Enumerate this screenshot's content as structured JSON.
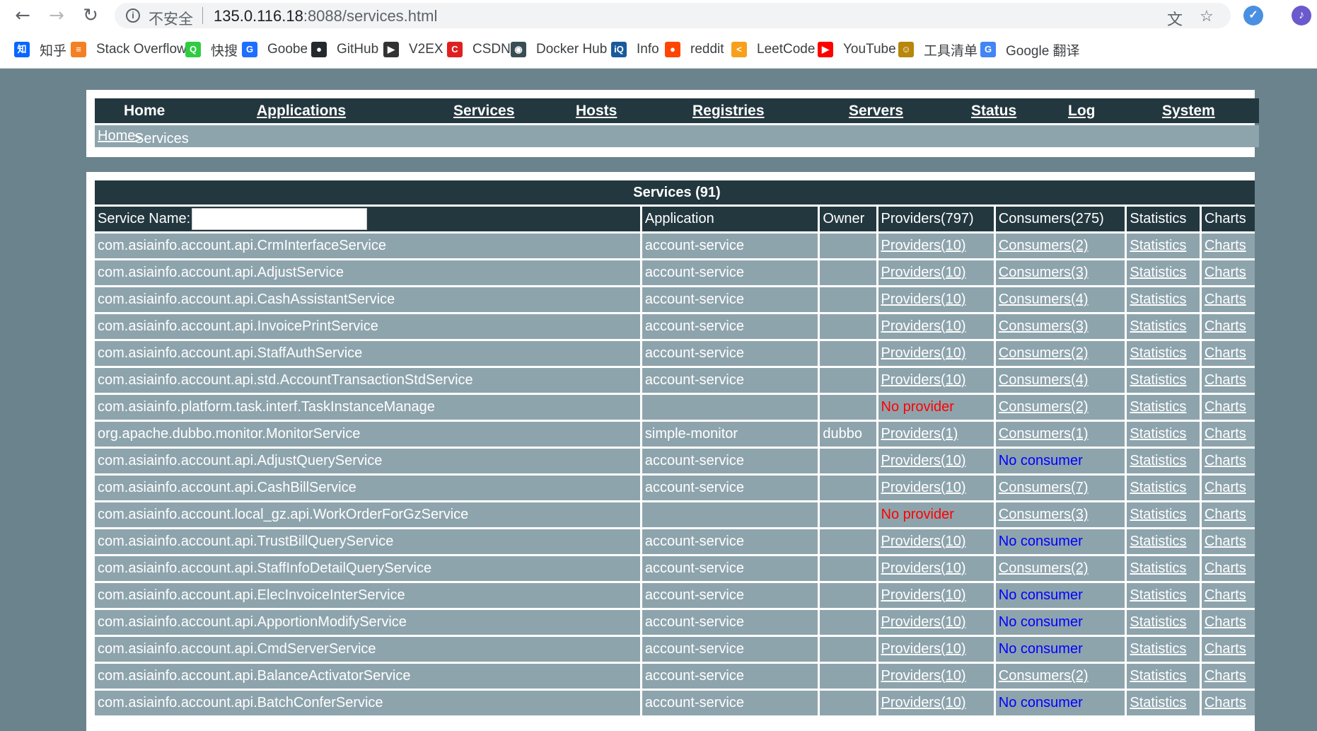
{
  "browser": {
    "insecure_label": "不安全",
    "url_host": "135.0.116.18",
    "url_rest": ":8088/services.html",
    "bookmarks": [
      {
        "label": "知乎",
        "icon": "zhihu-icon",
        "color": "#0a66ff",
        "glyph": "知"
      },
      {
        "label": "Stack Overflow",
        "icon": "stackoverflow-icon",
        "color": "#f48024",
        "glyph": "≡"
      },
      {
        "label": "快搜",
        "icon": "kuaisou-icon",
        "color": "#2ecc40",
        "glyph": "Q"
      },
      {
        "label": "Goobe",
        "icon": "goobe-icon",
        "color": "#1e6fff",
        "glyph": "G"
      },
      {
        "label": "GitHub",
        "icon": "github-icon",
        "color": "#24292e",
        "glyph": "●"
      },
      {
        "label": "V2EX",
        "icon": "v2ex-icon",
        "color": "#333333",
        "glyph": "▶"
      },
      {
        "label": "CSDN",
        "icon": "csdn-icon",
        "color": "#e02020",
        "glyph": "C"
      },
      {
        "label": "Docker Hub",
        "icon": "dockerhub-icon",
        "color": "#394d54",
        "glyph": "◉"
      },
      {
        "label": "Info",
        "icon": "infoq-icon",
        "color": "#1a5a9c",
        "glyph": "iQ"
      },
      {
        "label": "reddit",
        "icon": "reddit-icon",
        "color": "#ff4500",
        "glyph": "●"
      },
      {
        "label": "LeetCode",
        "icon": "leetcode-icon",
        "color": "#f89f1b",
        "glyph": "<"
      },
      {
        "label": "YouTube",
        "icon": "youtube-icon",
        "color": "#ff0000",
        "glyph": "▶"
      },
      {
        "label": "工具清单",
        "icon": "toolkit-icon",
        "color": "#b8860b",
        "glyph": "☺"
      },
      {
        "label": "Google 翻译",
        "icon": "google-translate-icon",
        "color": "#4285f4",
        "glyph": "G"
      }
    ]
  },
  "nav": {
    "items": [
      "Home",
      "Applications",
      "Services",
      "Hosts",
      "Registries",
      "Servers",
      "Status",
      "Log",
      "System"
    ],
    "breadcrumb_home": "Home",
    "breadcrumb_sep": " > ",
    "breadcrumb_current": "Services"
  },
  "table": {
    "title": "Services (91)",
    "search_label": "Service Name:",
    "search_value": "",
    "headers": {
      "application": "Application",
      "owner": "Owner",
      "providers": "Providers(797)",
      "consumers": "Consumers(275)",
      "statistics": "Statistics",
      "charts": "Charts"
    },
    "rows": [
      {
        "service": "com.asiainfo.account.api.CrmInterfaceService",
        "application": "account-service",
        "owner": "",
        "providers": "Providers(10)",
        "provider_none": false,
        "consumers": "Consumers(2)",
        "consumer_none": false,
        "statistics": "Statistics",
        "charts": "Charts"
      },
      {
        "service": "com.asiainfo.account.api.AdjustService",
        "application": "account-service",
        "owner": "",
        "providers": "Providers(10)",
        "provider_none": false,
        "consumers": "Consumers(3)",
        "consumer_none": false,
        "statistics": "Statistics",
        "charts": "Charts"
      },
      {
        "service": "com.asiainfo.account.api.CashAssistantService",
        "application": "account-service",
        "owner": "",
        "providers": "Providers(10)",
        "provider_none": false,
        "consumers": "Consumers(4)",
        "consumer_none": false,
        "statistics": "Statistics",
        "charts": "Charts"
      },
      {
        "service": "com.asiainfo.account.api.InvoicePrintService",
        "application": "account-service",
        "owner": "",
        "providers": "Providers(10)",
        "provider_none": false,
        "consumers": "Consumers(3)",
        "consumer_none": false,
        "statistics": "Statistics",
        "charts": "Charts"
      },
      {
        "service": "com.asiainfo.account.api.StaffAuthService",
        "application": "account-service",
        "owner": "",
        "providers": "Providers(10)",
        "provider_none": false,
        "consumers": "Consumers(2)",
        "consumer_none": false,
        "statistics": "Statistics",
        "charts": "Charts"
      },
      {
        "service": "com.asiainfo.account.api.std.AccountTransactionStdService",
        "application": "account-service",
        "owner": "",
        "providers": "Providers(10)",
        "provider_none": false,
        "consumers": "Consumers(4)",
        "consumer_none": false,
        "statistics": "Statistics",
        "charts": "Charts"
      },
      {
        "service": "com.asiainfo.platform.task.interf.TaskInstanceManage",
        "application": "",
        "owner": "",
        "providers": "No provider",
        "provider_none": true,
        "consumers": "Consumers(2)",
        "consumer_none": false,
        "statistics": "Statistics",
        "charts": "Charts"
      },
      {
        "service": "org.apache.dubbo.monitor.MonitorService",
        "application": "simple-monitor",
        "owner": "dubbo",
        "providers": "Providers(1)",
        "provider_none": false,
        "consumers": "Consumers(1)",
        "consumer_none": false,
        "statistics": "Statistics",
        "charts": "Charts"
      },
      {
        "service": "com.asiainfo.account.api.AdjustQueryService",
        "application": "account-service",
        "owner": "",
        "providers": "Providers(10)",
        "provider_none": false,
        "consumers": "No consumer",
        "consumer_none": true,
        "statistics": "Statistics",
        "charts": "Charts"
      },
      {
        "service": "com.asiainfo.account.api.CashBillService",
        "application": "account-service",
        "owner": "",
        "providers": "Providers(10)",
        "provider_none": false,
        "consumers": "Consumers(7)",
        "consumer_none": false,
        "statistics": "Statistics",
        "charts": "Charts"
      },
      {
        "service": "com.asiainfo.account.local_gz.api.WorkOrderForGzService",
        "application": "",
        "owner": "",
        "providers": "No provider",
        "provider_none": true,
        "consumers": "Consumers(3)",
        "consumer_none": false,
        "statistics": "Statistics",
        "charts": "Charts"
      },
      {
        "service": "com.asiainfo.account.api.TrustBillQueryService",
        "application": "account-service",
        "owner": "",
        "providers": "Providers(10)",
        "provider_none": false,
        "consumers": "No consumer",
        "consumer_none": true,
        "statistics": "Statistics",
        "charts": "Charts"
      },
      {
        "service": "com.asiainfo.account.api.StaffInfoDetailQueryService",
        "application": "account-service",
        "owner": "",
        "providers": "Providers(10)",
        "provider_none": false,
        "consumers": "Consumers(2)",
        "consumer_none": false,
        "statistics": "Statistics",
        "charts": "Charts"
      },
      {
        "service": "com.asiainfo.account.api.ElecInvoiceInterService",
        "application": "account-service",
        "owner": "",
        "providers": "Providers(10)",
        "provider_none": false,
        "consumers": "No consumer",
        "consumer_none": true,
        "statistics": "Statistics",
        "charts": "Charts"
      },
      {
        "service": "com.asiainfo.account.api.ApportionModifyService",
        "application": "account-service",
        "owner": "",
        "providers": "Providers(10)",
        "provider_none": false,
        "consumers": "No consumer",
        "consumer_none": true,
        "statistics": "Statistics",
        "charts": "Charts"
      },
      {
        "service": "com.asiainfo.account.api.CmdServerService",
        "application": "account-service",
        "owner": "",
        "providers": "Providers(10)",
        "provider_none": false,
        "consumers": "No consumer",
        "consumer_none": true,
        "statistics": "Statistics",
        "charts": "Charts"
      },
      {
        "service": "com.asiainfo.account.api.BalanceActivatorService",
        "application": "account-service",
        "owner": "",
        "providers": "Providers(10)",
        "provider_none": false,
        "consumers": "Consumers(2)",
        "consumer_none": false,
        "statistics": "Statistics",
        "charts": "Charts"
      },
      {
        "service": "com.asiainfo.account.api.BatchConferService",
        "application": "account-service",
        "owner": "",
        "providers": "Providers(10)",
        "provider_none": false,
        "consumers": "No consumer",
        "consumer_none": true,
        "statistics": "Statistics",
        "charts": "Charts"
      }
    ]
  }
}
